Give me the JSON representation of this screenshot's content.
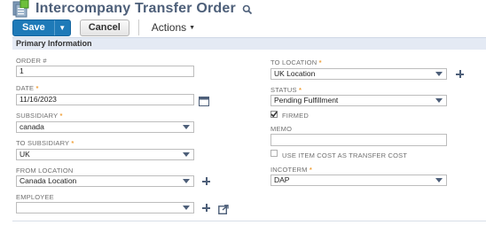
{
  "header": {
    "title": "Intercompany Transfer Order",
    "page_icon": "transfer-order-icon",
    "search_icon": "search-icon"
  },
  "toolbar": {
    "save_label": "Save",
    "cancel_label": "Cancel",
    "actions_label": "Actions"
  },
  "section": {
    "title": "Primary Information"
  },
  "fields": {
    "order_number": {
      "label": "ORDER #",
      "value": "1"
    },
    "date": {
      "label": "DATE",
      "value": "11/16/2023"
    },
    "subsidiary": {
      "label": "SUBSIDIARY",
      "value": "canada"
    },
    "to_subsidiary": {
      "label": "TO SUBSIDIARY",
      "value": "UK"
    },
    "from_location": {
      "label": "FROM LOCATION",
      "value": "Canada Location"
    },
    "employee": {
      "label": "EMPLOYEE",
      "value": ""
    },
    "to_location": {
      "label": "TO LOCATION",
      "value": "UK Location"
    },
    "status": {
      "label": "STATUS",
      "value": "Pending Fulfillment"
    },
    "firmed": {
      "label": "FIRMED",
      "checked": true
    },
    "memo": {
      "label": "MEMO",
      "value": ""
    },
    "use_item_cost": {
      "label": "USE ITEM COST AS TRANSFER COST",
      "checked": false
    },
    "incoterm": {
      "label": "INCOTERM",
      "value": "DAP"
    }
  },
  "required_marker": "*",
  "colors": {
    "accent": "#1e7ab8",
    "title": "#4d5f79",
    "section_bg": "#e4eaf4",
    "required": "#f0a13a"
  }
}
